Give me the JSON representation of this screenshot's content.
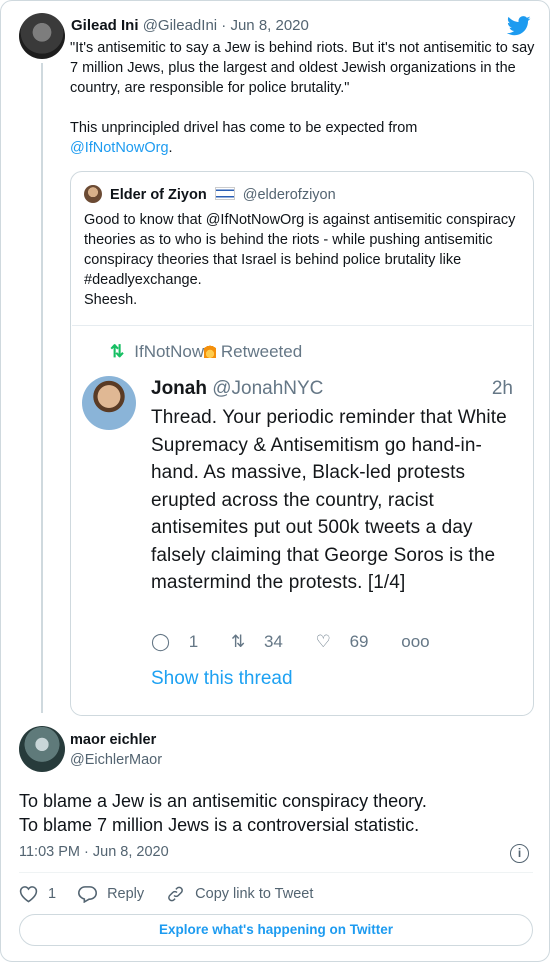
{
  "brand_color": "#1d9bf0",
  "tweet": {
    "author_name": "Gilead Ini",
    "author_handle": "@GileadIni",
    "separator": "·",
    "date": "Jun 8, 2020",
    "text_line1": "\"It's antisemitic to say a Jew is behind riots. But it's not antisemitic to say 7 million Jews, plus the largest and oldest Jewish organizations in the country, are responsible for police brutality.\"",
    "text_line2": "This unprincipled drivel has come to be expected from",
    "mention": "@IfNotNowOrg",
    "mention_suffix": "."
  },
  "quote": {
    "author_name": "Elder of Ziyon",
    "author_handle": "@elderofziyon",
    "text": "Good to know that @IfNotNowOrg is against antisemitic conspiracy theories as to who is behind the riots - while pushing antisemitic conspiracy theories that Israel is behind police brutality like #deadlyexchange.",
    "text_line2": "Sheesh."
  },
  "screenshot": {
    "retweeted_by": "IfNotNow",
    "retweeted_label": "Retweeted",
    "name": "Jonah",
    "handle": "@JonahNYC",
    "time": "2h",
    "text": "Thread. Your periodic reminder that White Supremacy & Antisemitism go hand-in-hand. As massive, Black-led protests erupted across the country, racist antisemites put out 500k tweets a day falsely claiming that George Soros is the mastermind the protests. [1/4]",
    "replies": "1",
    "retweets": "34",
    "likes": "69",
    "more": "ooo",
    "show_thread": "Show this thread"
  },
  "reply": {
    "author_name": "maor eichler",
    "author_handle": "@EichlerMaor",
    "text_line1": "To blame a Jew is an antisemitic conspiracy theory.",
    "text_line2": "To blame 7 million Jews is a controversial statistic.",
    "timestamp": "11:03 PM · Jun 8, 2020",
    "info": "i",
    "like_count": "1",
    "reply_label": "Reply",
    "copy_label": "Copy link to Tweet",
    "explore_label": "Explore what's happening on Twitter"
  }
}
